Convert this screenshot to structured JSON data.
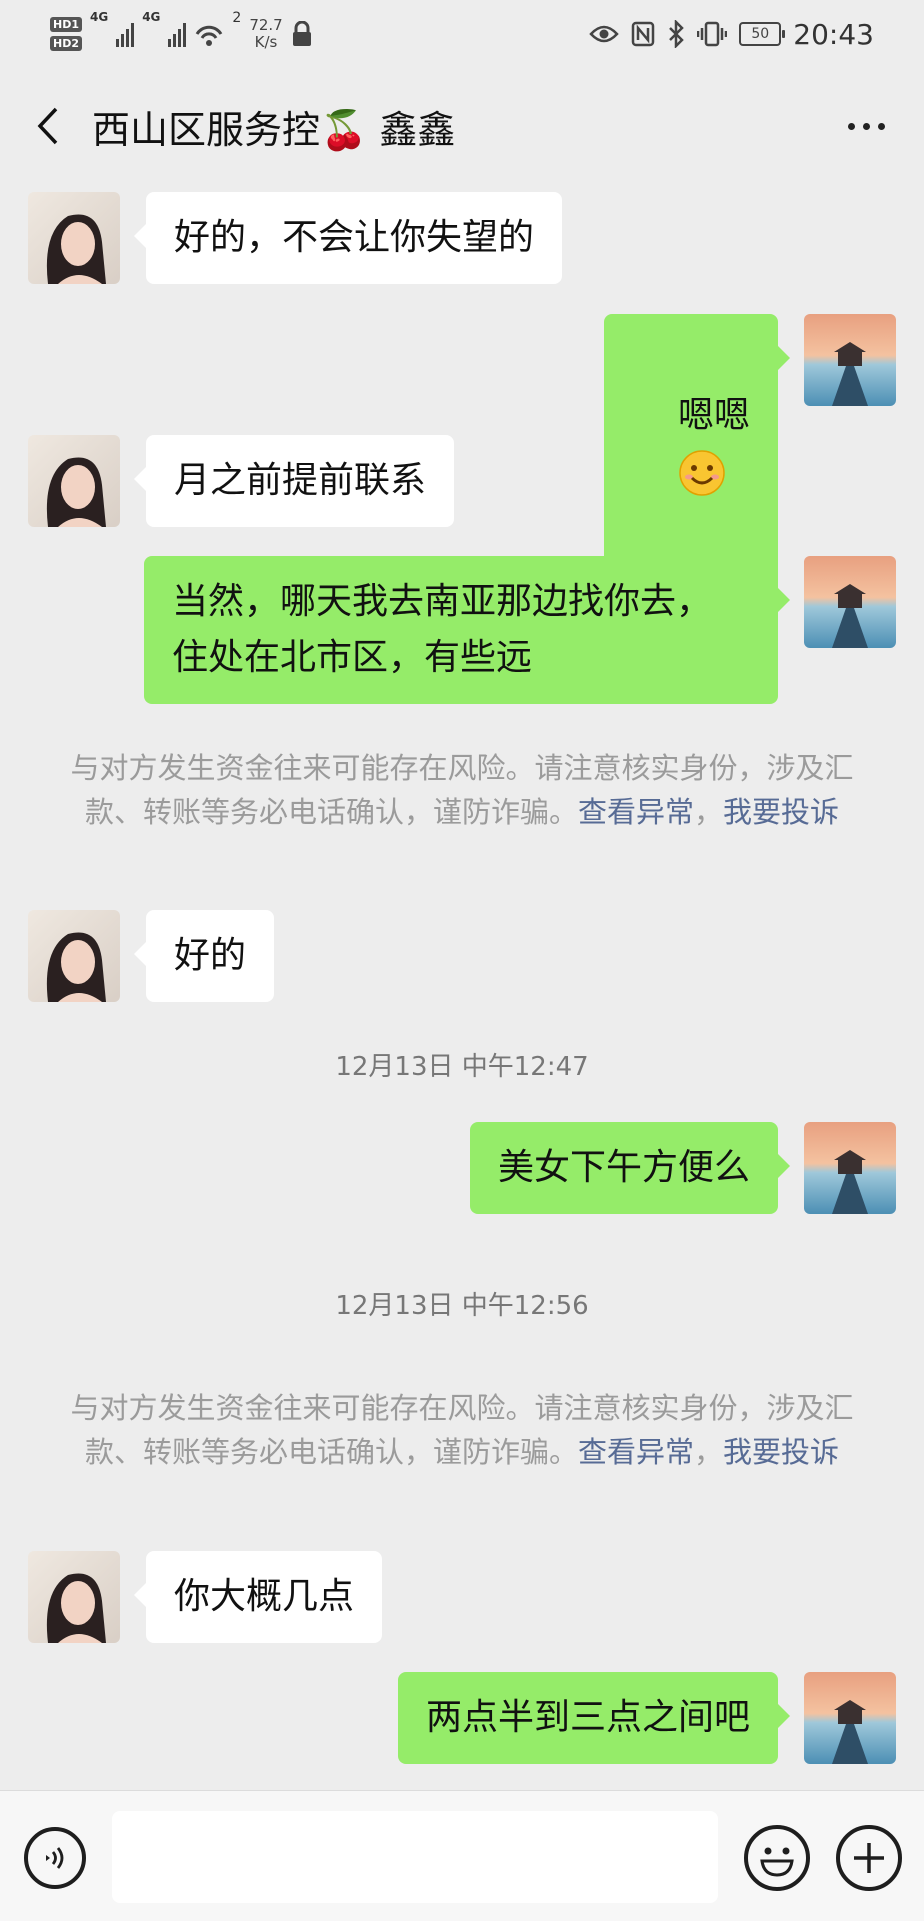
{
  "status_bar": {
    "hd1": "HD1",
    "hd2": "HD2",
    "net1": "4G",
    "net2": "4G",
    "wifi_num": "2",
    "speed_value": "72.7",
    "speed_unit": "K/s",
    "battery": "50",
    "time": "20:43"
  },
  "header": {
    "title": "西山区服务控🍒 鑫鑫"
  },
  "messages": [
    {
      "side": "left",
      "text": "好的，不会让你失望的"
    },
    {
      "side": "right",
      "text": "嗯嗯"
    },
    {
      "side": "left",
      "text": "月之前提前联系"
    },
    {
      "side": "right",
      "text": "当然，哪天我去南亚那边找你去，\n住处在北市区，有些远"
    },
    {
      "side": "left",
      "text": "好的"
    },
    {
      "side": "right",
      "text": "美女下午方便么"
    },
    {
      "side": "left",
      "text": "你大概几点"
    },
    {
      "side": "right",
      "text": "两点半到三点之间吧"
    }
  ],
  "notices": [
    {
      "text": "与对方发生资金往来可能存在风险。请注意核实身份，涉及汇款、转账等务必电话确认，谨防诈骗。",
      "link1": "查看异常",
      "separator": "，",
      "link2": "我要投诉"
    },
    {
      "text": "与对方发生资金往来可能存在风险。请注意核实身份，涉及汇款、转账等务必电话确认，谨防诈骗。",
      "link1": "查看异常",
      "separator": "，",
      "link2": "我要投诉"
    }
  ],
  "timestamps": [
    "12月13日 中午12:47",
    "12月13日 中午12:56"
  ],
  "input": {
    "placeholder": ""
  },
  "colors": {
    "background": "#ededed",
    "sent_bubble": "#95ec69",
    "received_bubble": "#ffffff",
    "link": "#576b95"
  }
}
